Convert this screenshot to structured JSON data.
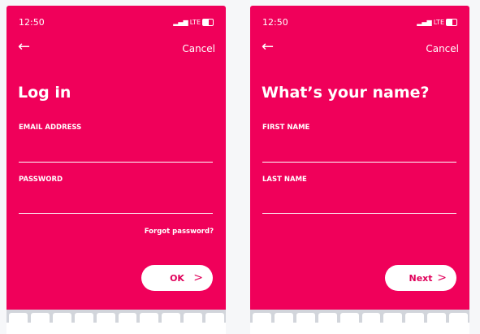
{
  "screens": [
    {
      "status": {
        "time": "12:50",
        "network": "LTE"
      },
      "back_icon": "arrow-left-icon",
      "cancel": "Cancel",
      "title": "Log in",
      "fields": [
        {
          "label": "EMAIL ADDRESS",
          "value": ""
        },
        {
          "label": "PASSWORD",
          "value": ""
        }
      ],
      "forgot": "Forgot password?",
      "button": "OK"
    },
    {
      "status": {
        "time": "12:50",
        "network": "LTE"
      },
      "back_icon": "arrow-left-icon",
      "cancel": "Cancel",
      "title": "What’s your name?",
      "fields": [
        {
          "label": "FIRST NAME",
          "value": ""
        },
        {
          "label": "LAST NAME",
          "value": ""
        }
      ],
      "button": "Next"
    }
  ],
  "colors": {
    "brand": "#f0005a",
    "button_text": "#e0005a"
  }
}
